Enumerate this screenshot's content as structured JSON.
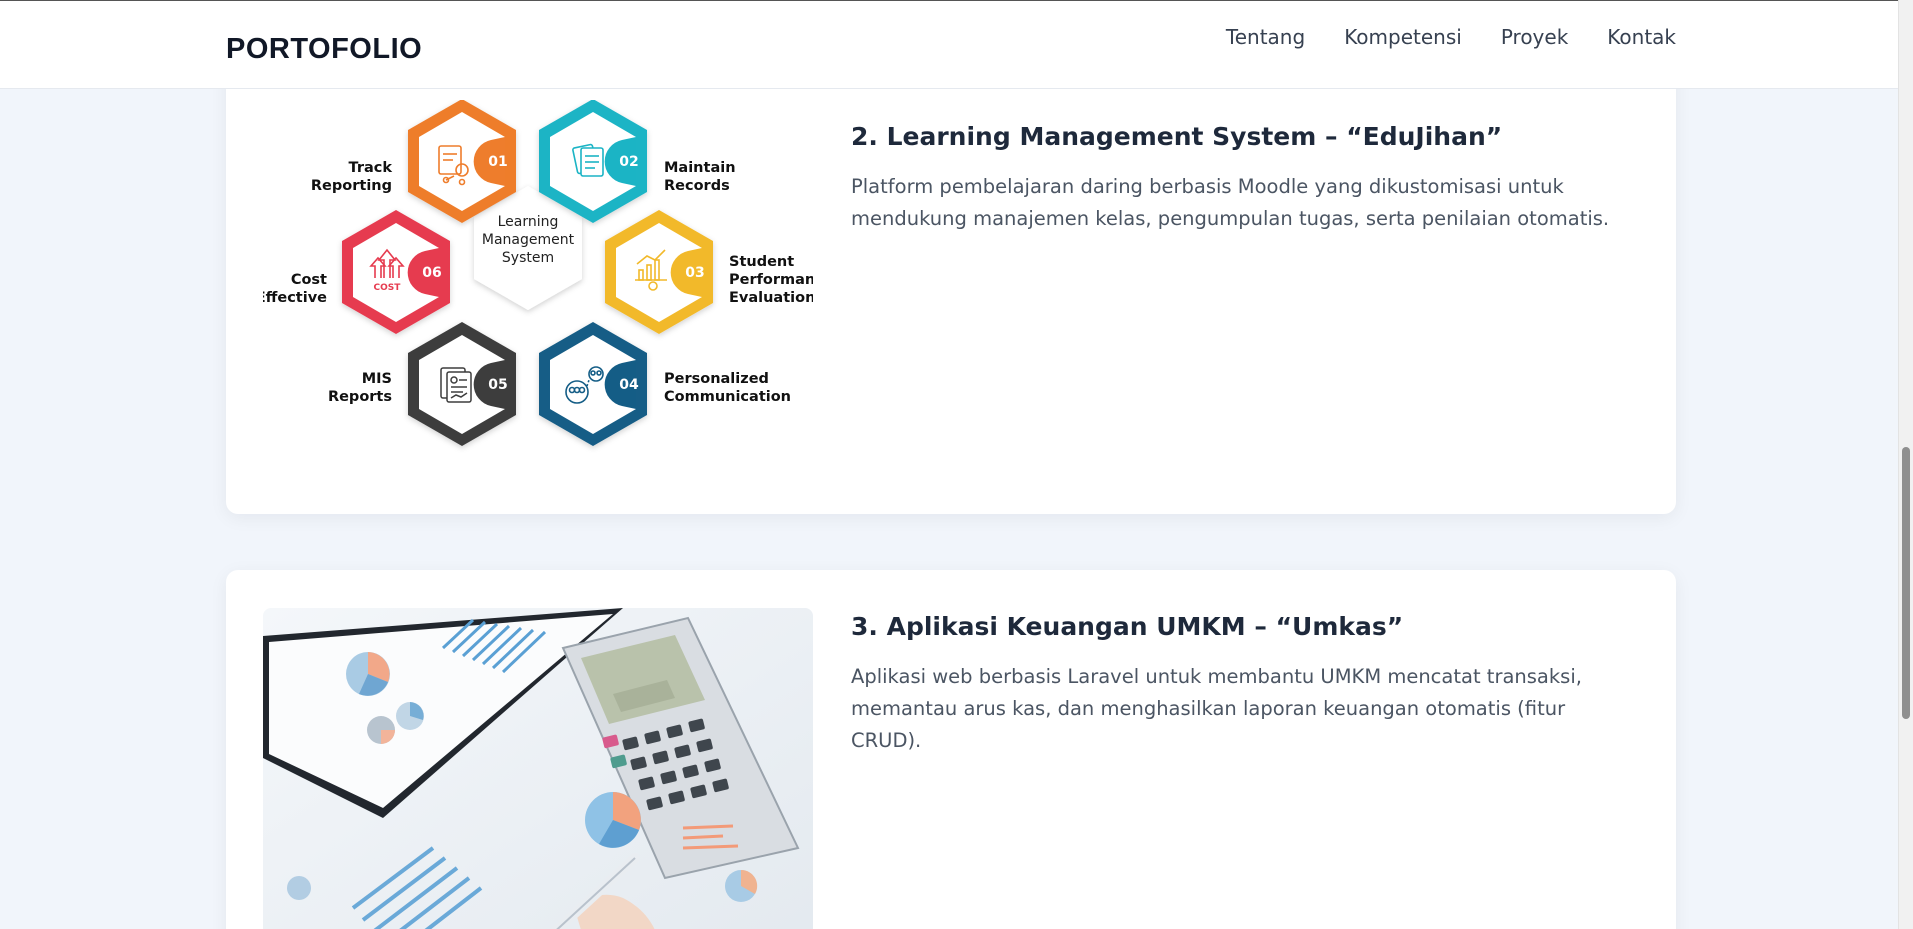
{
  "header": {
    "brand": "PORTOFOLIO",
    "nav": [
      "Tentang",
      "Kompetensi",
      "Proyek",
      "Kontak"
    ]
  },
  "projects": [
    {
      "title": "2. Learning Management System – “EduJihan”",
      "description": "Platform pembelajaran daring berbasis Moodle yang dikustomisasi untuk mendukung manajemen kelas, pengumpulan tugas, serta penilaian otomatis.",
      "figure": {
        "center_lines": [
          "Learning",
          "Management",
          "System"
        ],
        "items": [
          {
            "number": "01",
            "label_lines": [
              "Track",
              "Reporting"
            ],
            "color": "#ee7d2c",
            "icon": "report-icon"
          },
          {
            "number": "02",
            "label_lines": [
              "Maintain",
              "Records"
            ],
            "color": "#1bb4c5",
            "icon": "documents-icon"
          },
          {
            "number": "03",
            "label_lines": [
              "Student",
              "Performance",
              "Evaluation"
            ],
            "color": "#f2b92a",
            "icon": "performance-chart-icon"
          },
          {
            "number": "04",
            "label_lines": [
              "Personalized",
              "Communication"
            ],
            "color": "#145d86",
            "icon": "users-communication-icon"
          },
          {
            "number": "05",
            "label_lines": [
              "MIS",
              "Reports"
            ],
            "color": "#3d3d3d",
            "icon": "mis-report-icon"
          },
          {
            "number": "06",
            "label_lines": [
              "Cost",
              "Effective"
            ],
            "color": "#e63b4f",
            "icon": "cost-arrows-icon"
          }
        ],
        "cost_icon_text": "COST"
      }
    },
    {
      "title": "3. Aplikasi Keuangan UMKM – “Umkas”",
      "description": "Aplikasi web berbasis Laravel untuk membantu UMKM mencatat transaksi, memantau arus kas, dan menghasilkan laporan keuangan otomatis (fitur CRUD).",
      "photo_subject": "calculator-and-finance-charts-photo"
    }
  ],
  "colors": {
    "page_bg": "#f1f5fb",
    "card_bg": "#ffffff",
    "title": "#1e293b",
    "text": "#4b5563"
  }
}
